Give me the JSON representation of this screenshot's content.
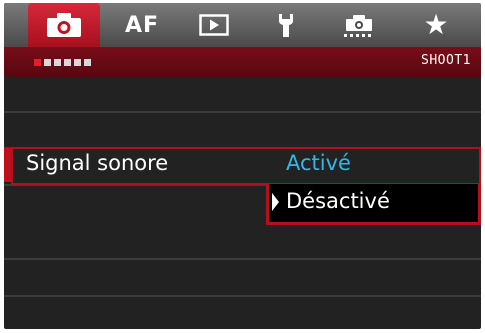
{
  "tabs": [
    {
      "name": "shooting",
      "icon": "camera-icon",
      "active": true
    },
    {
      "name": "autofocus",
      "label": "AF"
    },
    {
      "name": "playback",
      "icon": "playback-icon"
    },
    {
      "name": "setup",
      "icon": "wrench-icon"
    },
    {
      "name": "custom-functions",
      "icon": "custom-functions-icon"
    },
    {
      "name": "my-menu",
      "icon": "star-icon",
      "glyph": "★"
    }
  ],
  "page": {
    "label": "SHOOT1",
    "indicator_count": 6,
    "current_index": 0
  },
  "setting": {
    "name": "Signal sonore",
    "options": [
      "Activé",
      "Désactivé"
    ],
    "highlighted_option": "Activé",
    "cursor_option": "Désactivé"
  },
  "colors": {
    "accent_red": "#c0101e",
    "highlight_blue": "#33b8e6",
    "background": "#222222"
  }
}
